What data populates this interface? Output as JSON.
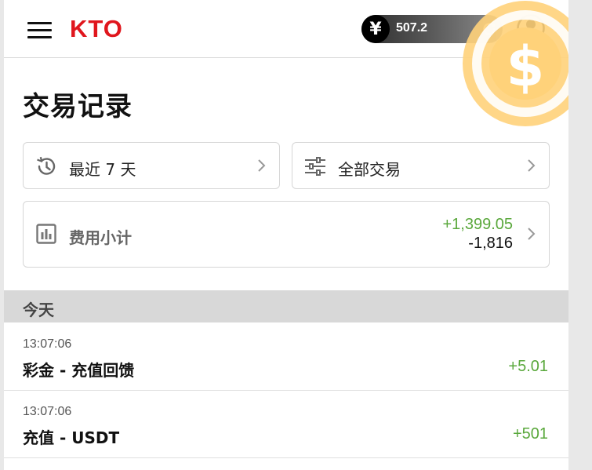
{
  "header": {
    "menu_icon": "hamburger-menu-icon",
    "logo_text": "KTO",
    "balance": {
      "currency_symbol": "¥",
      "amount": "507.2",
      "refresh_icon": "refresh-icon"
    },
    "avatar_icon": "user-avatar-icon"
  },
  "colors": {
    "brand_red": "#e0161d",
    "positive_green": "#5aa83c",
    "coin_yellow": "#ffd27a"
  },
  "page": {
    "title": "交易记录"
  },
  "filters": {
    "days": {
      "label": "最近 7 天",
      "icon": "history-icon"
    },
    "type": {
      "label": "全部交易",
      "icon": "sliders-icon"
    }
  },
  "summary": {
    "icon": "bar-chart-icon",
    "label": "费用小计",
    "income": "+1,399.05",
    "expense": "-1,816"
  },
  "sections": [
    {
      "label": "今天",
      "rows": [
        {
          "time": "13:07:06",
          "title": "彩金 - 充值回馈",
          "amount": "+5.01"
        },
        {
          "time": "13:07:06",
          "title": "充值 - USDT",
          "amount": "+501"
        }
      ]
    }
  ]
}
